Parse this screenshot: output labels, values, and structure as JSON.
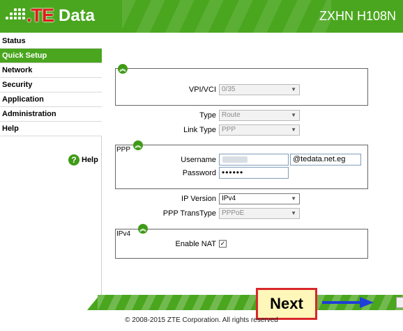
{
  "header": {
    "logo_te": ".TE",
    "logo_data": "Data",
    "model": "ZXHN H108N",
    "brand_color": "#4aa61e",
    "logo_red": "#e21b1b"
  },
  "sidebar": {
    "items": [
      {
        "label": "Status",
        "active": false
      },
      {
        "label": "Quick Setup",
        "active": true
      },
      {
        "label": "Network",
        "active": false
      },
      {
        "label": "Security",
        "active": false
      },
      {
        "label": "Application",
        "active": false
      },
      {
        "label": "Administration",
        "active": false
      },
      {
        "label": "Help",
        "active": false
      }
    ],
    "help_link": "Help",
    "help_icon": "question-icon"
  },
  "form": {
    "vpi_vci": {
      "label": "VPI/VCI",
      "value": "0/35"
    },
    "type": {
      "label": "Type",
      "value": "Route"
    },
    "link_type": {
      "label": "Link Type",
      "value": "PPP"
    },
    "ppp": {
      "title": "PPP",
      "username_label": "Username",
      "username_suffix": "@tedata.net.eg",
      "password_label": "Password",
      "password_value": "••••••"
    },
    "ip_version": {
      "label": "IP Version",
      "value": "IPv4"
    },
    "ppp_transtype": {
      "label": "PPP TransType",
      "value": "PPPoE"
    },
    "ipv4": {
      "title": "IPv4",
      "enable_nat_label": "Enable NAT",
      "enable_nat_checked": "✓"
    },
    "collapse_icon": "︽"
  },
  "footer": {
    "next_label": "Next",
    "copyright": "© 2008-2015 ZTE Corporation. All rights reserved"
  }
}
